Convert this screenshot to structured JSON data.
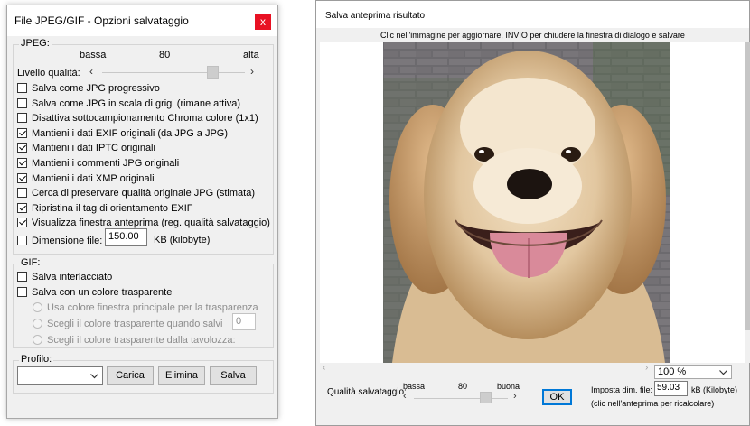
{
  "save_dialog": {
    "title": "File JPEG/GIF - Opzioni salvataggio",
    "close_label": "x",
    "jpeg_group_label": "JPEG:",
    "quality_low": "bassa",
    "quality_value": "80",
    "quality_high": "alta",
    "quality_label": "Livello qualità:",
    "quality_level": 80,
    "options": [
      {
        "label": "Salva come JPG progressivo",
        "checked": false
      },
      {
        "label": "Salva come JPG in scala di grigi (rimane attiva)",
        "checked": false
      },
      {
        "label": "Disattiva sottocampionamento Chroma colore (1x1)",
        "checked": false
      },
      {
        "label": "Mantieni i dati EXIF originali (da JPG a JPG)",
        "checked": true
      },
      {
        "label": "Mantieni i dati IPTC originali",
        "checked": true
      },
      {
        "label": "Mantieni i commenti JPG originali",
        "checked": true
      },
      {
        "label": "Mantieni i dati XMP originali",
        "checked": true
      },
      {
        "label": "Cerca di preservare qualità originale JPG (stimata)",
        "checked": false
      },
      {
        "label": "Ripristina il tag di orientamento EXIF",
        "checked": true
      },
      {
        "label": "Visualizza finestra anteprima (reg. qualità salvataggio)",
        "checked": true
      }
    ],
    "file_size": {
      "label": "Dimensione file:",
      "checked": false,
      "value": "150.00",
      "unit": "KB (kilobyte)"
    },
    "gif_group_label": "GIF:",
    "gif_options": [
      {
        "label": "Salva interlacciato",
        "checked": false
      },
      {
        "label": "Salva con un colore trasparente",
        "checked": false
      }
    ],
    "gif_radios": [
      {
        "label": "Usa colore finestra principale per la trasparenza"
      },
      {
        "label": "Scegli il colore trasparente quando salvi"
      },
      {
        "label": "Scegli il colore trasparente dalla tavolozza:"
      }
    ],
    "transparent_index": "0",
    "profile_group_label": "Profilo:",
    "profile_value": "",
    "buttons": {
      "load": "Carica",
      "delete": "Elimina",
      "save": "Salva"
    }
  },
  "preview_dialog": {
    "title": "Salva anteprima risultato",
    "instruction": "Clic nell'immagine per aggiornare, INVIO per chiudere la finestra di dialogo e salvare",
    "zoom_value": "100 %",
    "quality_label": "Qualità salvataggio:",
    "quality_low": "bassa",
    "quality_value": "80",
    "quality_high": "buona",
    "quality_level": 80,
    "ok_label": "OK",
    "size_label": "Imposta dim. file:",
    "size_value": "59.03",
    "size_unit": "kB (Kilobyte)",
    "size_hint": "(clic nell'anteprima per ricalcolare)",
    "colors": {
      "accent": "#0078d7",
      "close": "#e81123"
    }
  }
}
